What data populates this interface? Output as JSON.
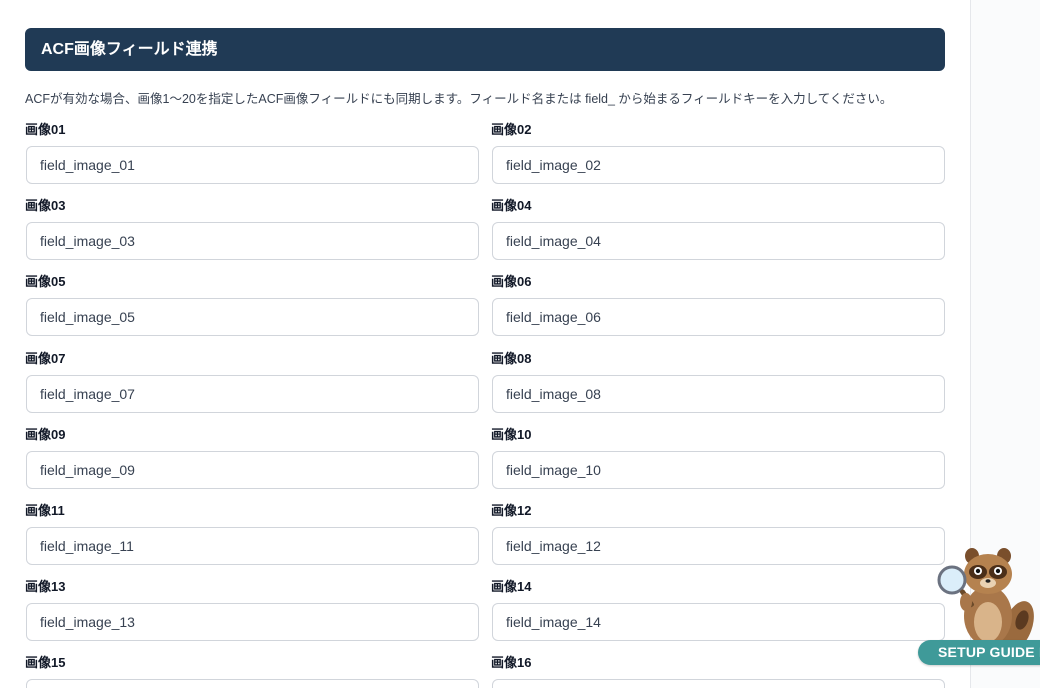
{
  "section": {
    "title": "ACF画像フィールド連携",
    "description": "ACFが有効な場合、画像1〜20を指定したACF画像フィールドにも同期します。フィールド名または field_ から始まるフィールドキーを入力してください。"
  },
  "fields": [
    {
      "label": "画像01",
      "value": "field_image_01"
    },
    {
      "label": "画像02",
      "value": "field_image_02"
    },
    {
      "label": "画像03",
      "value": "field_image_03"
    },
    {
      "label": "画像04",
      "value": "field_image_04"
    },
    {
      "label": "画像05",
      "value": "field_image_05"
    },
    {
      "label": "画像06",
      "value": "field_image_06"
    },
    {
      "label": "画像07",
      "value": "field_image_07"
    },
    {
      "label": "画像08",
      "value": "field_image_08"
    },
    {
      "label": "画像09",
      "value": "field_image_09"
    },
    {
      "label": "画像10",
      "value": "field_image_10"
    },
    {
      "label": "画像11",
      "value": "field_image_11"
    },
    {
      "label": "画像12",
      "value": "field_image_12"
    },
    {
      "label": "画像13",
      "value": "field_image_13"
    },
    {
      "label": "画像14",
      "value": "field_image_14"
    },
    {
      "label": "画像15",
      "value": ""
    },
    {
      "label": "画像16",
      "value": ""
    }
  ],
  "guide_button": {
    "label": "SETUP GUIDE M",
    "icon": "raccoon-magnifier-mascot"
  },
  "colors": {
    "header_bg": "#203a55",
    "guide_button_bg": "#3f9a99"
  }
}
